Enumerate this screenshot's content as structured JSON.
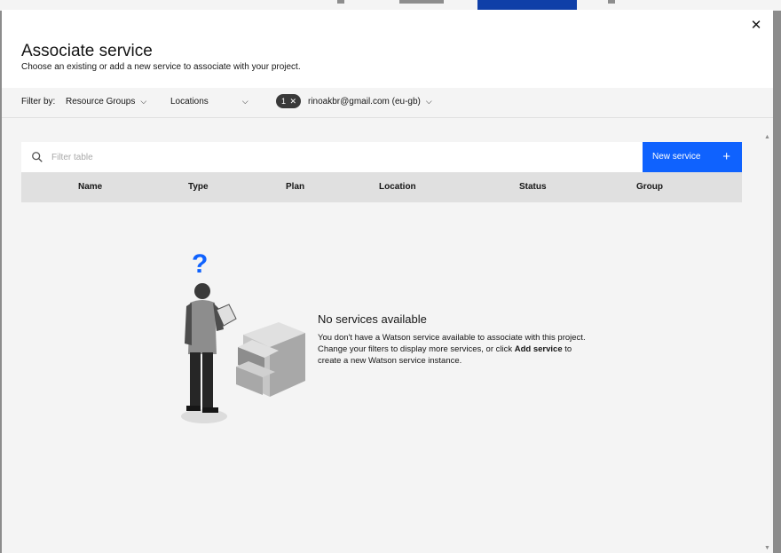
{
  "modal": {
    "title": "Associate service",
    "subtitle": "Choose an existing or add a new service to associate with your project.",
    "close_icon": "close-icon"
  },
  "filters": {
    "label": "Filter by:",
    "resource_groups": "Resource Groups",
    "locations": "Locations",
    "tag_count": "1",
    "account": "rinoakbr@gmail.com (eu-gb)"
  },
  "search": {
    "placeholder": "Filter table",
    "icon": "search-icon"
  },
  "new_service": {
    "label": "New service",
    "icon": "+"
  },
  "table": {
    "columns": [
      "Name",
      "Type",
      "Plan",
      "Location",
      "Status",
      "Group"
    ]
  },
  "empty_state": {
    "title": "No services available",
    "body_1": "You don't have a Watson service available to associate with this project. Change your filters to display more services, or click ",
    "body_bold_1": "Add service",
    "body_2": " to create a new Watson service instance.",
    "illustration": "person-with-cabinet-illustration"
  },
  "colors": {
    "primary": "#0f62fe",
    "header_bg": "#e0e0e0",
    "panel_bg": "#f4f4f4"
  }
}
